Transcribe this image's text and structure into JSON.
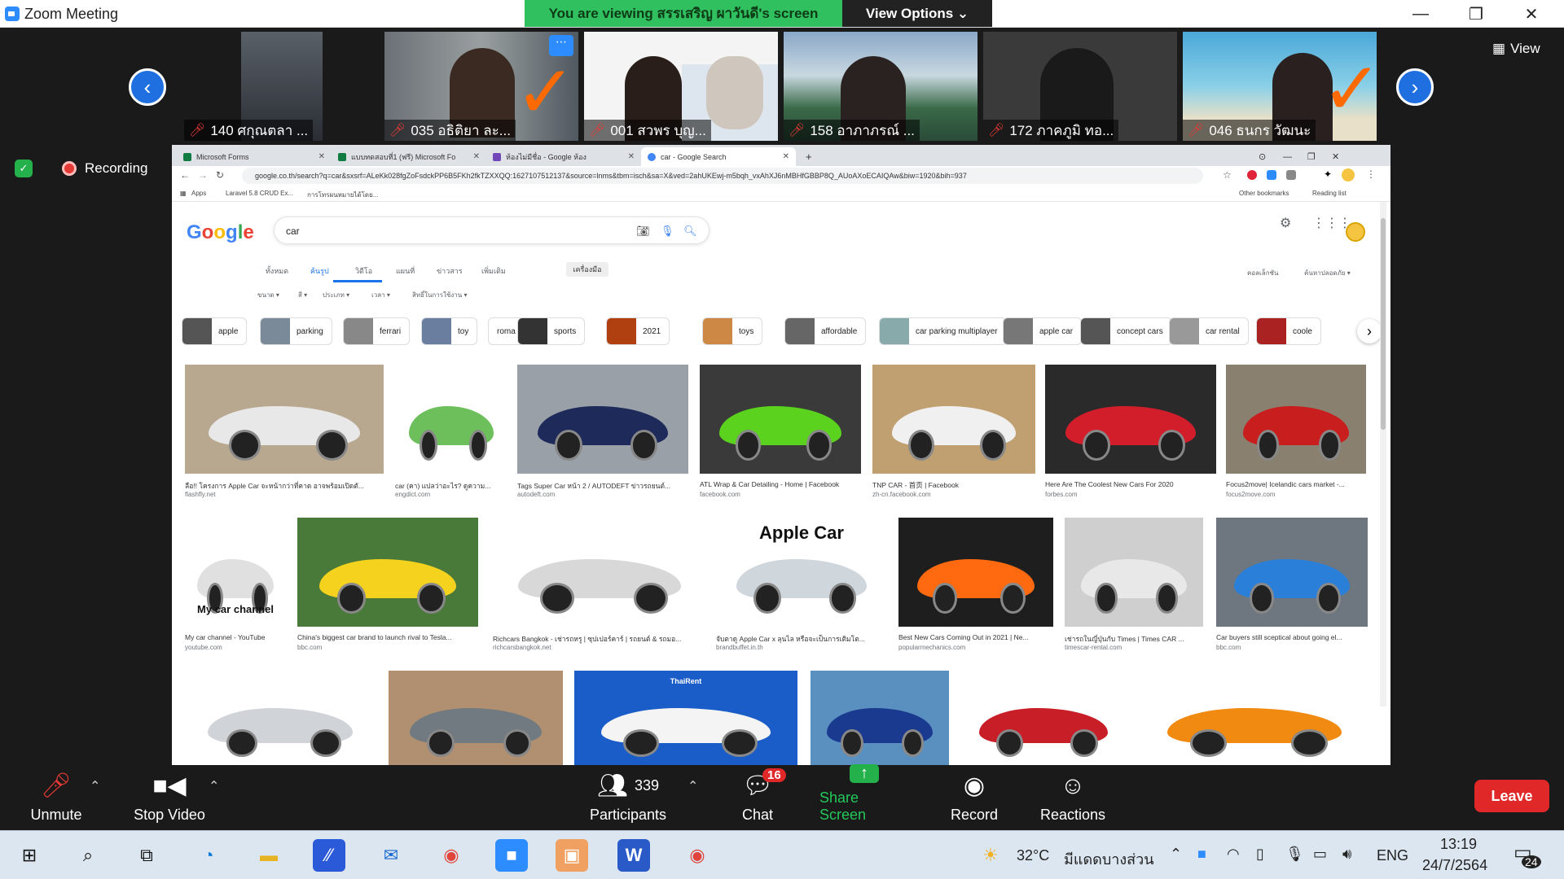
{
  "window": {
    "title": "Zoom Meeting",
    "minimize": "—",
    "restore": "❐",
    "close": "✕"
  },
  "banner": {
    "viewing": "You are viewing สรรเสริญ ผาวันดี's screen",
    "view_options": "View Options ⌄"
  },
  "view_button": {
    "icon": "▦",
    "label": "View"
  },
  "recording": {
    "shield": "✓",
    "label": "Recording"
  },
  "participants": [
    {
      "name": "140 ศกุณตลา ..."
    },
    {
      "name": "035 อธิติยา ละ..."
    },
    {
      "name": "001 สวพร บุญ..."
    },
    {
      "name": "158 อาภาภรณ์ ..."
    },
    {
      "name": "172 ภาคภูมิ ทอ..."
    },
    {
      "name": "046 ธนกร วัฒนะ"
    }
  ],
  "nav": {
    "prev": "‹",
    "next": "›"
  },
  "browser": {
    "tabs": [
      {
        "label": "Microsoft Forms",
        "color": "#107c41"
      },
      {
        "label": "แบบทดสอบที่1 (ฟรี) Microsoft Fo",
        "color": "#107c41"
      },
      {
        "label": "ห้องไม่มีชื่อ - Google ห้อง",
        "color": "#7248b9"
      },
      {
        "label": "car - Google Search",
        "color": "#ffffff"
      }
    ],
    "new_tab": "+",
    "url": "google.co.th/search?q=car&sxsrf=ALeKk028fgZoFsdckPP6B5FKh2fkTZXXQQ:1627107512137&source=lnms&tbm=isch&sa=X&ved=2ahUKEwj-m5bqh_vxAhXJ6nMBHfGBBP8Q_AUoAXoECAIQAw&biw=1920&bih=937",
    "bookmarks": {
      "apps": "Apps",
      "b1": "Laravel 5.8 CRUD Ex...",
      "b2": "การโทรผนหมายได้โดย...",
      "other": "Other bookmarks",
      "reading": "Reading list"
    }
  },
  "google": {
    "logo": "Google",
    "query": "car",
    "nav_tabs": [
      "ทั้งหมด",
      "ค้นรูป",
      "วิดีโอ",
      "แผนที่",
      "ข่าวสาร",
      "เพิ่มเติม"
    ],
    "tools": "เครื่องมือ",
    "filters": [
      "ขนาด ▾",
      "สี ▾",
      "ประเภท ▾",
      "เวลา ▾",
      "สิทธิ์ในการใช้งาน ▾"
    ],
    "right_links": {
      "collections": "คอลเล็กชัน",
      "safesearch": "ค้นหาปลอดภัย ▾"
    },
    "chips": [
      {
        "label": "apple",
        "color": "#555"
      },
      {
        "label": "parking",
        "color": "#7a8a99"
      },
      {
        "label": "ferrari",
        "color": "#888"
      },
      {
        "label": "toy",
        "color": "#6a7ea0"
      },
      {
        "label": "roma",
        "color": ""
      },
      {
        "label": "sports",
        "color": "#333"
      },
      {
        "label": "2021",
        "color": "#b04010"
      },
      {
        "label": "toys",
        "color": "#c84"
      },
      {
        "label": "affordable",
        "color": "#666"
      },
      {
        "label": "car parking multiplayer",
        "color": "#8aa"
      },
      {
        "label": "apple car",
        "color": "#777"
      },
      {
        "label": "concept cars",
        "color": "#555"
      },
      {
        "label": "car rental",
        "color": "#999"
      },
      {
        "label": "coole",
        "color": "#a22"
      }
    ],
    "row1": [
      {
        "caption": "ลือ!! โครงการ Apple Car จะหน้ากว่าที่คาด อาจพร้อมเปิดตั...",
        "source": "flashfly.net",
        "bg": "#b8a890",
        "car": "#e8e8e8"
      },
      {
        "caption": "car (คา) แปลว่าอะไร? ดูความ...",
        "source": "engdict.com",
        "bg": "#ffffff",
        "car": "#6cbf5a"
      },
      {
        "caption": "Tags Super Car หน้า 2 / AUTODEFT ข่าวรถยนต์...",
        "source": "autodeft.com",
        "bg": "#9aa0a8",
        "car": "#1e2a5a"
      },
      {
        "caption": "ATL Wrap & Car Detailing - Home | Facebook",
        "source": "facebook.com",
        "bg": "#3a3a3a",
        "car": "#5ad21e"
      },
      {
        "caption": "TNP CAR - 首页 | Facebook",
        "source": "zh-cn.facebook.com",
        "bg": "#c0a070",
        "car": "#f0f0f0"
      },
      {
        "caption": "Here Are The Coolest New Cars For 2020",
        "source": "forbes.com",
        "bg": "#2a2a2a",
        "car": "#d21e2a"
      },
      {
        "caption": "Focus2move| Icelandic cars market -...",
        "source": "focus2move.com",
        "bg": "#8a8070",
        "car": "#c81e1e"
      }
    ],
    "row2": [
      {
        "caption": "My car channel - YouTube",
        "source": "youtube.com",
        "bg": "#ffffff",
        "car": "#e0e0e0",
        "overlay": "My car channel"
      },
      {
        "caption": "China's biggest car brand to launch rival to Tesla...",
        "source": "bbc.com",
        "bg": "#4a7a3a",
        "car": "#f5d21e",
        "overlay": ""
      },
      {
        "caption": "Richcars Bangkok - เช่ารถหรู | ซุปเปอร์คาร์ | รถยนต์ & รถมอ...",
        "source": "richcarsbangkok.net",
        "bg": "#ffffff",
        "car": "#d8d8d8",
        "overlay": ""
      },
      {
        "caption": "จับตาดู Apple Car x ลุนไล หรือจะเป็นการเติมโต...",
        "source": "brandbuffet.in.th",
        "bg": "#ffffff",
        "car": "#cfd6dc",
        "overlay": "Apple Car"
      },
      {
        "caption": "Best New Cars Coming Out in 2021 | Ne...",
        "source": "popularmechanics.com",
        "bg": "#1e1e1e",
        "car": "#ff6a10",
        "overlay": ""
      },
      {
        "caption": "เช่ารถในญี่ปุ่นกับ Times | Times CAR ...",
        "source": "timescar-rental.com",
        "bg": "#cfcfcf",
        "car": "#e8e8e8",
        "overlay": ""
      },
      {
        "caption": "Car buyers still sceptical about going el...",
        "source": "bbc.com",
        "bg": "#6e7680",
        "car": "#2a80d8",
        "overlay": ""
      }
    ],
    "row3": [
      {
        "bg": "#ffffff",
        "car": "#d0d4d8",
        "overlay": ""
      },
      {
        "bg": "#b09070",
        "car": "#707a80",
        "overlay": ""
      },
      {
        "bg": "#1a5cc8",
        "car": "#f4f4f4",
        "overlay": "ThaiRent"
      },
      {
        "bg": "#5a90c0",
        "car": "#1a3a90",
        "overlay": ""
      },
      {
        "bg": "#ffffff",
        "car": "#c81e28",
        "overlay": ""
      },
      {
        "bg": "#ffffff",
        "car": "#f08a10",
        "overlay": ""
      }
    ]
  },
  "controls": {
    "unmute": "Unmute",
    "stop_video": "Stop Video",
    "participants_count": "339",
    "participants": "Participants",
    "chat_badge": "16",
    "chat": "Chat",
    "share_screen": "Share Screen",
    "record": "Record",
    "reactions": "Reactions",
    "leave": "Leave"
  },
  "taskbar": {
    "weather_temp": "32°C",
    "weather_text": "มีแดดบางส่วน",
    "lang": "ENG",
    "time": "13:19",
    "date": "24/7/2564",
    "notif_count": "24"
  }
}
